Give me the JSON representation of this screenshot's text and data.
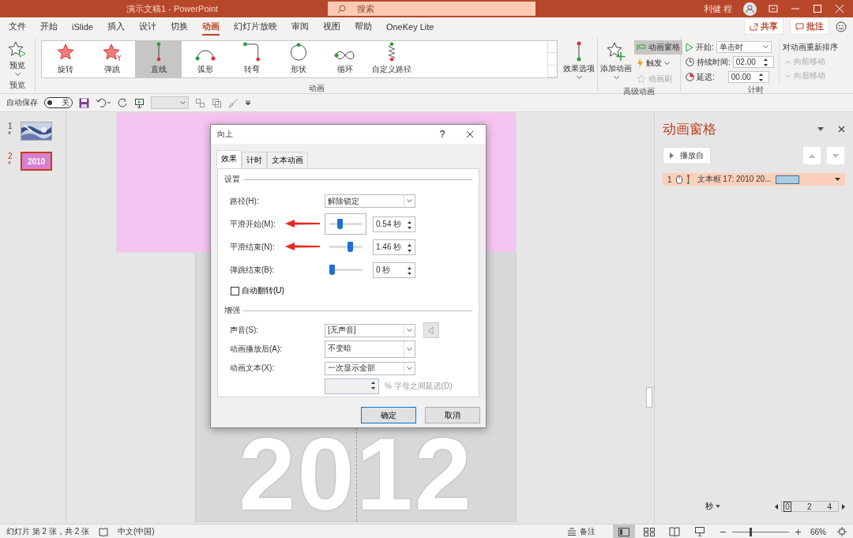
{
  "window": {
    "title": "演示文稿1  -  PowerPoint",
    "search": {
      "placeholder": "搜索"
    },
    "user": "利健 程"
  },
  "ribbon_tabs": [
    {
      "label": "文件",
      "selected": false
    },
    {
      "label": "开始",
      "selected": false
    },
    {
      "label": "iSlide",
      "selected": false
    },
    {
      "label": "插入",
      "selected": false
    },
    {
      "label": "设计",
      "selected": false
    },
    {
      "label": "切换",
      "selected": false
    },
    {
      "label": "动画",
      "selected": true
    },
    {
      "label": "幻灯片放映",
      "selected": false
    },
    {
      "label": "审阅",
      "selected": false
    },
    {
      "label": "视图",
      "selected": false
    },
    {
      "label": "帮助",
      "selected": false
    },
    {
      "label": "OneKey Lite",
      "selected": false
    }
  ],
  "share_button": "共享",
  "comments_button": "批注",
  "ribbon": {
    "preview": {
      "label": "预览",
      "group": "预览"
    },
    "animations": {
      "group": "动画",
      "items": [
        {
          "label": "旋转",
          "kind": "spin",
          "selected": false
        },
        {
          "label": "弹跳",
          "kind": "bounce",
          "selected": false
        },
        {
          "label": "直线",
          "kind": "line",
          "selected": true
        },
        {
          "label": "弧形",
          "kind": "arc",
          "selected": false
        },
        {
          "label": "转弯",
          "kind": "turn",
          "selected": false
        },
        {
          "label": "形状",
          "kind": "shape",
          "selected": false
        },
        {
          "label": "循环",
          "kind": "loop",
          "selected": false
        },
        {
          "label": "自定义路径",
          "kind": "custom",
          "selected": false
        }
      ]
    },
    "effect_options": "效果选项",
    "advanced": {
      "group": "高级动画",
      "add": "添加动画",
      "pane": {
        "label": "动画窗格",
        "selected": true
      },
      "trigger": "触发",
      "painter": {
        "label": "动画刷",
        "disabled": true
      }
    },
    "timing": {
      "group": "计时",
      "start_label": "开始:",
      "start_value": "单击时",
      "duration_label": "持续时间:",
      "duration": "02.00",
      "delay_label": "延迟:",
      "delay": "00.00",
      "reorder": "对动画重新排序",
      "move_earlier": {
        "label": "向前移动",
        "disabled": true
      },
      "move_later": {
        "label": "向后移动",
        "disabled": true
      }
    }
  },
  "quick_access": {
    "autosave": "自动保存",
    "toggle": {
      "label": "关",
      "on": false
    }
  },
  "slides": [
    {
      "number": "1",
      "marker": "*",
      "selected": false
    },
    {
      "number": "2",
      "marker": "*",
      "selected": true,
      "kind": "title",
      "text": "2010"
    }
  ],
  "slide": {
    "text": "2012"
  },
  "dialog": {
    "title": "向上",
    "help": "?",
    "tabs": [
      {
        "label": "效果",
        "selected": true
      },
      {
        "label": "计时",
        "selected": false
      },
      {
        "label": "文本动画",
        "selected": false
      }
    ],
    "settings_heading": "设置",
    "settings": [
      {
        "kind": "dropdown",
        "label": "路径(H):",
        "value": "解除锁定"
      },
      {
        "kind": "slider",
        "label": "平滑开始(M):",
        "level": 0.3,
        "value": "0.54 秒",
        "focused": true,
        "annotated": true
      },
      {
        "kind": "slider",
        "label": "平滑结束(N):",
        "level": 0.66,
        "value": "1.46 秒",
        "focused": false,
        "annotated": true
      },
      {
        "kind": "slider",
        "label": "弹跳结束(B):",
        "level": 0,
        "value": "0 秒",
        "focused": false,
        "annotated": false
      },
      {
        "kind": "checkbox",
        "label": "自动翻转(U)",
        "checked": false
      }
    ],
    "enhance_heading": "增强",
    "enhancements": [
      {
        "kind": "sound",
        "label": "声音(S):",
        "value": "[无声音]"
      },
      {
        "kind": "dropdown",
        "label": "动画播放后(A):",
        "value": "不变暗"
      },
      {
        "kind": "dropdown",
        "label": "动画文本(X):",
        "value": "一次显示全部"
      },
      {
        "kind": "delay",
        "label": "% 字母之间延迟(D)",
        "disabled": true
      }
    ],
    "ok": "确定",
    "cancel": "取消"
  },
  "animation_pane": {
    "title": "动画窗格",
    "play_button": "播放自",
    "items": [
      {
        "number": "1",
        "label": "文本框 17: 2010 20...",
        "selected": true,
        "color": "#a9cde3"
      }
    ],
    "units": "秒",
    "scale": [
      "0",
      "2",
      "4"
    ]
  },
  "status_bar": {
    "slide_info": "幻灯片 第 2 张，共 2 张",
    "language": "中文(中国)",
    "notes": "备注",
    "views": [
      {
        "kind": "normal",
        "selected": true
      },
      {
        "kind": "sorter",
        "selected": false
      },
      {
        "kind": "reading",
        "selected": false
      },
      {
        "kind": "slideshow",
        "selected": false
      }
    ],
    "zoom": {
      "level": 0.32,
      "value": "66%"
    }
  }
}
